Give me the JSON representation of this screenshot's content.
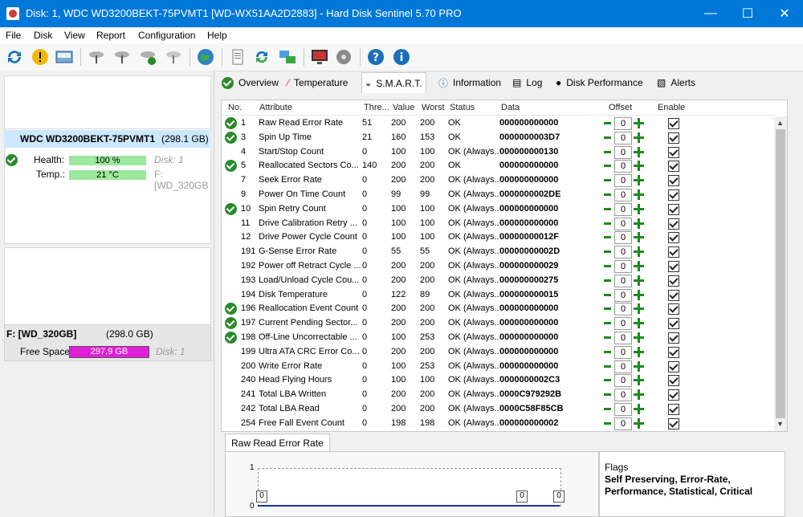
{
  "window": {
    "title": "Disk: 1, WDC WD3200BEKT-75PVMT1 [WD-WX51AA2D2883]  -  Hard Disk Sentinel 5.70 PRO",
    "min": "—",
    "max": "☐",
    "close": "✕"
  },
  "menu": [
    "File",
    "Disk",
    "View",
    "Report",
    "Configuration",
    "Help"
  ],
  "left": {
    "disk_name": "WDC WD3200BEKT-75PVMT1",
    "disk_size": "(298.1 GB)",
    "health_label": "Health:",
    "health_value": "100 %",
    "health_pct": 100,
    "disk_ref": "Disk: 1",
    "temp_label": "Temp.:",
    "temp_value": "21 °C",
    "temp_ref": "F: [WD_320GB",
    "partition_name": "F: [WD_320GB]",
    "partition_size": "(298.0 GB)",
    "free_label": "Free Space",
    "free_value": "297.9 GB",
    "free_ref": "Disk: 1"
  },
  "tabs": [
    "Overview",
    "Temperature",
    "S.M.A.R.T.",
    "Information",
    "Log",
    "Disk Performance",
    "Alerts"
  ],
  "columns": [
    "No.",
    "Attribute",
    "Thre...",
    "Value",
    "Worst",
    "Status",
    "Data",
    "Offset",
    "Enable"
  ],
  "rows": [
    {
      "no": "1",
      "attr": "Raw Read Error Rate",
      "thr": "51",
      "val": "200",
      "worst": "200",
      "status": "OK",
      "data": "000000000000",
      "icon": true
    },
    {
      "no": "3",
      "attr": "Spin Up Time",
      "thr": "21",
      "val": "160",
      "worst": "153",
      "status": "OK",
      "data": "0000000003D7",
      "icon": true
    },
    {
      "no": "4",
      "attr": "Start/Stop Count",
      "thr": "0",
      "val": "100",
      "worst": "100",
      "status": "OK (Always...",
      "data": "000000000130",
      "icon": false
    },
    {
      "no": "5",
      "attr": "Reallocated Sectors Co...",
      "thr": "140",
      "val": "200",
      "worst": "200",
      "status": "OK",
      "data": "000000000000",
      "icon": true
    },
    {
      "no": "7",
      "attr": "Seek Error Rate",
      "thr": "0",
      "val": "200",
      "worst": "200",
      "status": "OK (Always...",
      "data": "000000000000",
      "icon": false
    },
    {
      "no": "9",
      "attr": "Power On Time Count",
      "thr": "0",
      "val": "99",
      "worst": "99",
      "status": "OK (Always...",
      "data": "0000000002DE",
      "icon": false
    },
    {
      "no": "10",
      "attr": "Spin Retry Count",
      "thr": "0",
      "val": "100",
      "worst": "100",
      "status": "OK (Always...",
      "data": "000000000000",
      "icon": true
    },
    {
      "no": "11",
      "attr": "Drive Calibration Retry ...",
      "thr": "0",
      "val": "100",
      "worst": "100",
      "status": "OK (Always...",
      "data": "000000000000",
      "icon": false
    },
    {
      "no": "12",
      "attr": "Drive Power Cycle Count",
      "thr": "0",
      "val": "100",
      "worst": "100",
      "status": "OK (Always...",
      "data": "00000000012F",
      "icon": false
    },
    {
      "no": "191",
      "attr": "G-Sense Error Rate",
      "thr": "0",
      "val": "55",
      "worst": "55",
      "status": "OK (Always...",
      "data": "00000000002D",
      "icon": false
    },
    {
      "no": "192",
      "attr": "Power off Retract Cycle ...",
      "thr": "0",
      "val": "200",
      "worst": "200",
      "status": "OK (Always...",
      "data": "000000000029",
      "icon": false
    },
    {
      "no": "193",
      "attr": "Load/Unload Cycle Cou...",
      "thr": "0",
      "val": "200",
      "worst": "200",
      "status": "OK (Always...",
      "data": "000000000275",
      "icon": false
    },
    {
      "no": "194",
      "attr": "Disk Temperature",
      "thr": "0",
      "val": "122",
      "worst": "89",
      "status": "OK (Always...",
      "data": "000000000015",
      "icon": false
    },
    {
      "no": "196",
      "attr": "Reallocation Event Count",
      "thr": "0",
      "val": "200",
      "worst": "200",
      "status": "OK (Always...",
      "data": "000000000000",
      "icon": true
    },
    {
      "no": "197",
      "attr": "Current Pending Sector...",
      "thr": "0",
      "val": "200",
      "worst": "200",
      "status": "OK (Always...",
      "data": "000000000000",
      "icon": true
    },
    {
      "no": "198",
      "attr": "Off-Line Uncorrectable ...",
      "thr": "0",
      "val": "100",
      "worst": "253",
      "status": "OK (Always...",
      "data": "000000000000",
      "icon": true
    },
    {
      "no": "199",
      "attr": "Ultra ATA CRC Error Co...",
      "thr": "0",
      "val": "200",
      "worst": "200",
      "status": "OK (Always...",
      "data": "000000000000",
      "icon": false
    },
    {
      "no": "200",
      "attr": "Write Error Rate",
      "thr": "0",
      "val": "100",
      "worst": "253",
      "status": "OK (Always...",
      "data": "000000000000",
      "icon": false
    },
    {
      "no": "240",
      "attr": "Head Flying Hours",
      "thr": "0",
      "val": "100",
      "worst": "100",
      "status": "OK (Always...",
      "data": "0000000002C3",
      "icon": false
    },
    {
      "no": "241",
      "attr": "Total LBA Written",
      "thr": "0",
      "val": "200",
      "worst": "200",
      "status": "OK (Always...",
      "data": "0000C979292B",
      "icon": false
    },
    {
      "no": "242",
      "attr": "Total LBA Read",
      "thr": "0",
      "val": "200",
      "worst": "200",
      "status": "OK (Always...",
      "data": "0000C58F85CB",
      "icon": false
    },
    {
      "no": "254",
      "attr": "Free Fall Event Count",
      "thr": "0",
      "val": "198",
      "worst": "198",
      "status": "OK (Always...",
      "data": "000000000002",
      "icon": false
    }
  ],
  "offset_value": "0",
  "bottom": {
    "tab": "Raw Read Error Rate",
    "graph_ymax": "1",
    "graph_ymin": "0",
    "graph_points": [
      "0",
      "0",
      "0"
    ],
    "flags_title": "Flags",
    "flags_text": "Self Preserving, Error-Rate, Performance, Statistical, Critical"
  },
  "colors": {
    "accent": "#0078d7",
    "health": "#9ce89c",
    "free": "#e020d8",
    "ok": "#2b8a2b"
  }
}
